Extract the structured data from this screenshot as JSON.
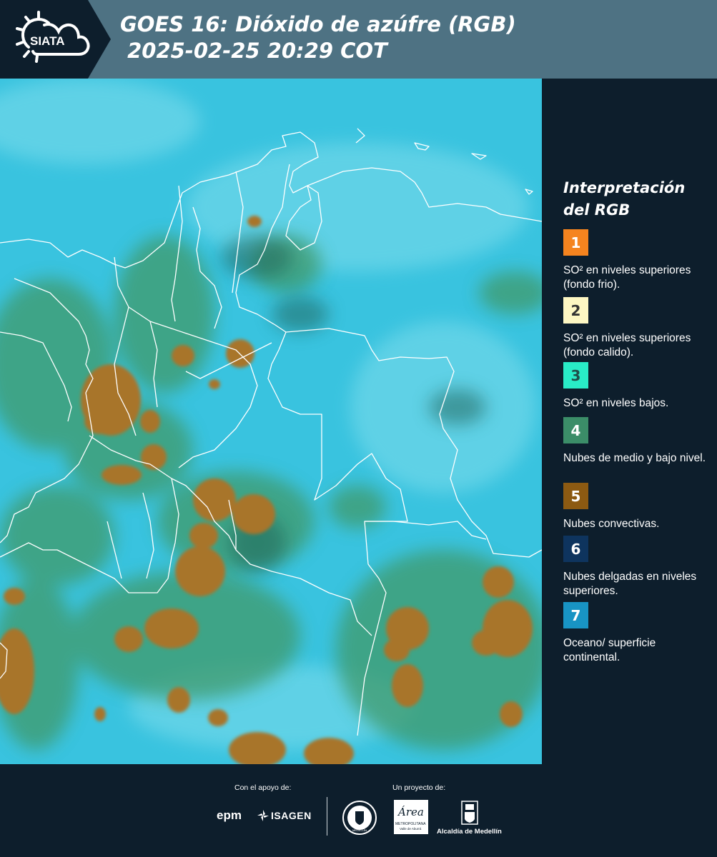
{
  "header": {
    "brand": "SIATA",
    "title_line1": "GOES 16: Dióxido de azúfre (RGB)",
    "title_line2": " 2025-02-25 20:29 COT"
  },
  "legend": {
    "title": "Interpretación del RGB",
    "items": [
      {
        "num": "1",
        "color": "#f5841f",
        "text_color": "#ffffff",
        "label": "SO² en niveles superiores (fondo frio)."
      },
      {
        "num": "2",
        "color": "#fdf7c3",
        "text_color": "#333333",
        "label": "SO² en niveles superiores (fondo calido)."
      },
      {
        "num": "3",
        "color": "#29ecc7",
        "text_color": "#1f4f49",
        "label": "SO² en niveles bajos."
      },
      {
        "num": "4",
        "color": "#3b8d68",
        "text_color": "#ffffff",
        "label": "Nubes de medio y bajo nivel."
      },
      {
        "num": "5",
        "color": "#8c5a12",
        "text_color": "#ffffff",
        "label": "Nubes convectivas."
      },
      {
        "num": "6",
        "color": "#0e345e",
        "text_color": "#ffffff",
        "label": "Nubes delgadas en niveles superiores."
      },
      {
        "num": "7",
        "color": "#1894c4",
        "text_color": "#ffffff",
        "label": "Oceano/ superficie continental."
      }
    ]
  },
  "map": {
    "background_color": "#39c3df",
    "cloud_colors": {
      "convective": "#a8742a",
      "low_mid": "#3f9a6a"
    }
  },
  "footer": {
    "support_label": "Con el apoyo de:",
    "project_label": "Un proyecto de:",
    "sponsors": [
      "epm",
      "ISAGEN"
    ],
    "partners": [
      "Área Metropolitana Valle de Aburrá",
      "Alcaldía de Medellín"
    ],
    "epm": "epm",
    "isagen": "ISAGEN",
    "area_name": "Área",
    "area_sub1": "METROPOLITANA",
    "area_sub2": "Valle de Aburrá",
    "alcaldia": "Alcaldía de Medellín",
    "seal_text": "MEDELLÍN"
  }
}
